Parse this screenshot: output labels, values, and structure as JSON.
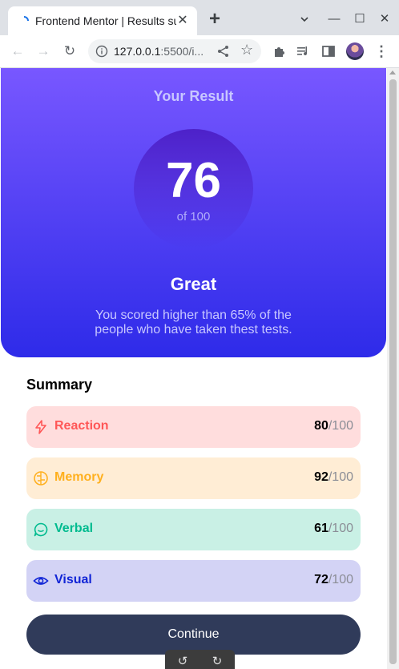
{
  "browser": {
    "tab_title": "Frontend Mentor | Results summary",
    "tab_close": "✕",
    "new_tab": "+",
    "url_host": "127.0.0.1",
    "url_rest": ":5500/i...",
    "window_controls": [
      "—",
      "☐",
      "✕"
    ]
  },
  "result": {
    "heading": "Your Result",
    "score": "76",
    "score_of": "of 100",
    "grade": "Great",
    "description": "You scored higher than 65% of the people who have taken thest tests."
  },
  "summary": {
    "title": "Summary",
    "items": [
      {
        "label": "Reaction",
        "score": "80",
        "max": "/100",
        "icon": "lightning-icon",
        "color": "#ff5757",
        "bg": "#ffdddd"
      },
      {
        "label": "Memory",
        "score": "92",
        "max": "/100",
        "icon": "brain-icon",
        "color": "#ffb01e",
        "bg": "#ffedd5"
      },
      {
        "label": "Verbal",
        "score": "61",
        "max": "/100",
        "icon": "chat-bubble-icon",
        "color": "#00bb8f",
        "bg": "#c9f0e5"
      },
      {
        "label": "Visual",
        "score": "72",
        "max": "/100",
        "icon": "eye-icon",
        "color": "#1125d6",
        "bg": "#d3d3f5"
      }
    ]
  },
  "continue_label": "Continue",
  "colors": {
    "gradient_top": "#7857ff",
    "gradient_bottom": "#2e2be9",
    "button_bg": "#303b5a"
  }
}
